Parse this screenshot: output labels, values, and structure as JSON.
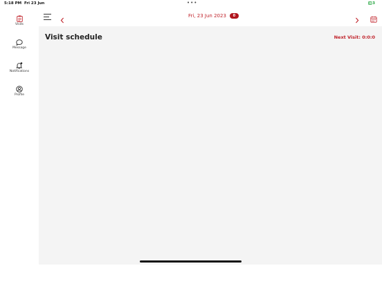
{
  "status": {
    "time": "5:18 PM",
    "day": "Fri 23 Jun",
    "dots": "•••",
    "battery": "3"
  },
  "sidebar": {
    "items": [
      {
        "label": "Visits",
        "icon": "clipboard-icon",
        "active": true
      },
      {
        "label": "Message",
        "icon": "chat-bubble-icon",
        "active": false
      },
      {
        "label": "Notifications",
        "icon": "bell-icon",
        "active": false
      },
      {
        "label": "Profile",
        "icon": "user-circle-icon",
        "active": false
      }
    ]
  },
  "header": {
    "date": "Fri, 23 Jun 2023",
    "badge": "0"
  },
  "main": {
    "title": "Visit schedule",
    "next_visit": "Next Visit: 0:0:0"
  },
  "colors": {
    "accent": "#c0222a",
    "badge": "#b0161e",
    "content_bg": "#f4f4f4",
    "battery": "#1fa33a"
  }
}
